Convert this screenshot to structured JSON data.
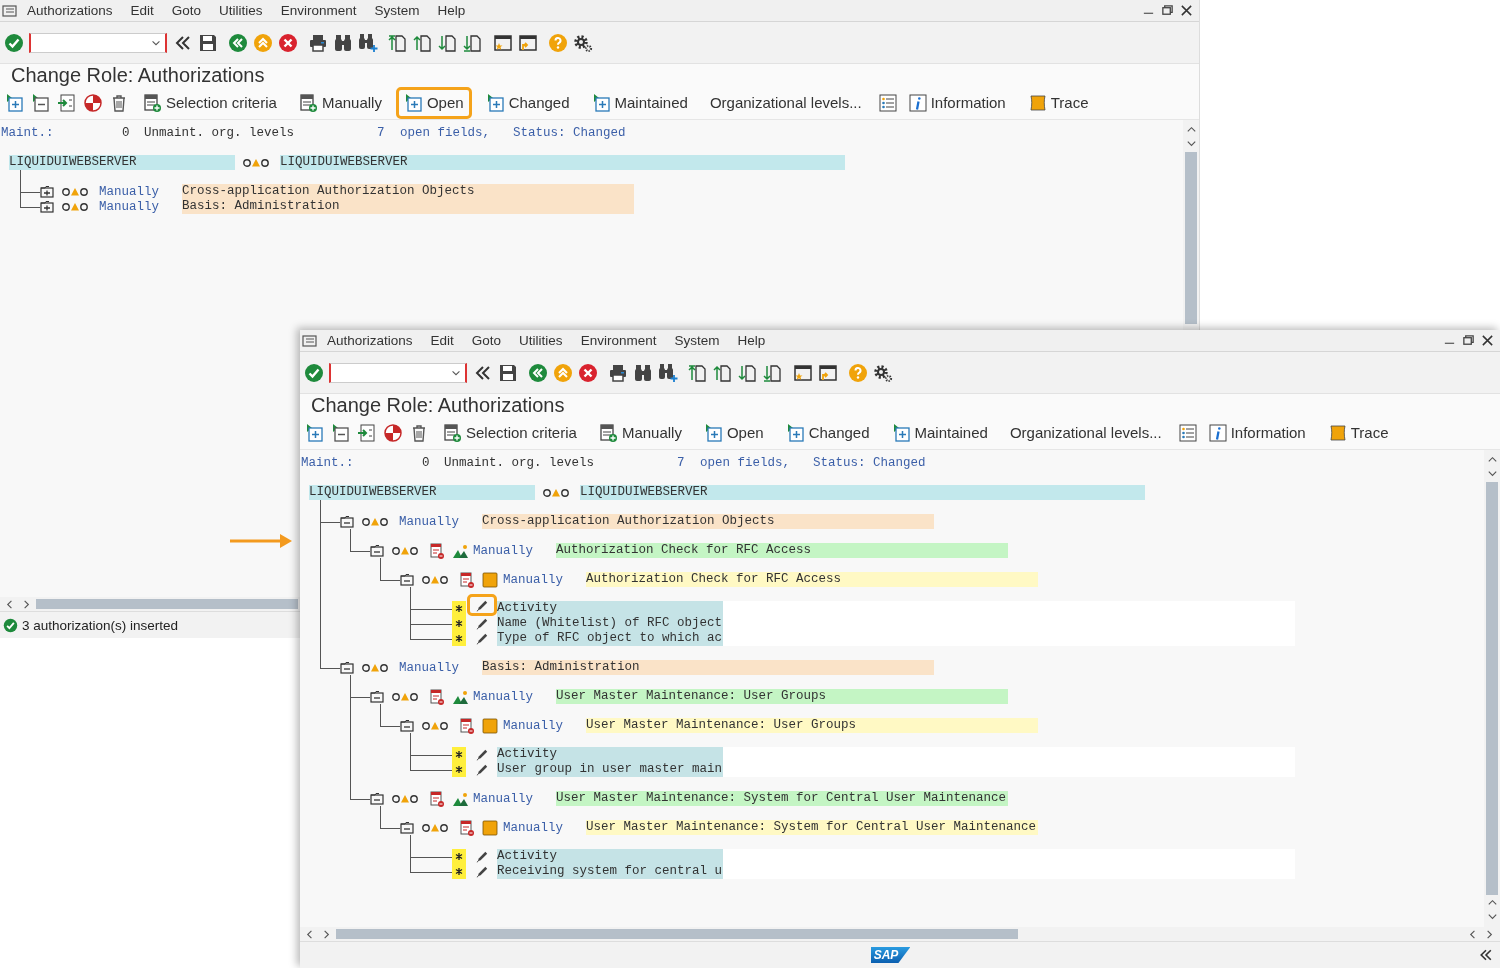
{
  "windows": [
    {
      "menu": [
        "Authorizations",
        "Edit",
        "Goto",
        "Utilities",
        "Environment",
        "System",
        "Help"
      ],
      "title": "Change Role: Authorizations",
      "app_toolbar": [
        {
          "label": "Selection criteria",
          "highlighted": false
        },
        {
          "label": "Manually",
          "highlighted": false
        },
        {
          "label": "Open",
          "highlighted": true
        },
        {
          "label": "Changed",
          "highlighted": false
        },
        {
          "label": "Maintained",
          "highlighted": false
        },
        {
          "label": "Organizational levels...",
          "highlighted": false
        },
        {
          "label": "Information",
          "highlighted": false
        },
        {
          "label": "Trace",
          "highlighted": false
        }
      ],
      "info": [
        {
          "text": "Maint.:",
          "link": true
        },
        {
          "text": "0",
          "link": false
        },
        {
          "text": "Unmaint. org. levels",
          "link": false
        },
        {
          "text": "7",
          "link": true
        },
        {
          "text": "open fields,",
          "link": true
        },
        {
          "text": "Status: Changed",
          "link": true
        }
      ],
      "tree": {
        "name": "LIQUIDUIWEBSERVER",
        "description": "LIQUIDUIWEBSERVER",
        "children": [
          {
            "kind": "class",
            "status": "Manually",
            "text": "Cross-application Authorization Objects",
            "expanded": false
          },
          {
            "kind": "class",
            "status": "Manually",
            "text": "Basis: Administration",
            "expanded": false
          }
        ]
      },
      "status_bar": {
        "message": "3 authorization(s) inserted"
      }
    },
    {
      "menu": [
        "Authorizations",
        "Edit",
        "Goto",
        "Utilities",
        "Environment",
        "System",
        "Help"
      ],
      "title": "Change Role: Authorizations",
      "app_toolbar": [
        {
          "label": "Selection criteria",
          "highlighted": false
        },
        {
          "label": "Manually",
          "highlighted": false
        },
        {
          "label": "Open",
          "highlighted": false
        },
        {
          "label": "Changed",
          "highlighted": false
        },
        {
          "label": "Maintained",
          "highlighted": false
        },
        {
          "label": "Organizational levels...",
          "highlighted": false
        },
        {
          "label": "Information",
          "highlighted": false
        },
        {
          "label": "Trace",
          "highlighted": false
        }
      ],
      "info": [
        {
          "text": "Maint.:",
          "link": true
        },
        {
          "text": "0",
          "link": false
        },
        {
          "text": "Unmaint. org. levels",
          "link": false
        },
        {
          "text": "7",
          "link": true
        },
        {
          "text": "open fields,",
          "link": true
        },
        {
          "text": "Status: Changed",
          "link": true
        }
      ],
      "tree": {
        "name": "LIQUIDUIWEBSERVER",
        "description": "LIQUIDUIWEBSERVER",
        "children": [
          {
            "kind": "class",
            "status": "Manually",
            "text": "Cross-application Authorization Objects",
            "expanded": true,
            "children": [
              {
                "kind": "object",
                "status": "Manually",
                "text": "Authorization Check for RFC Access",
                "expanded": true,
                "children": [
                  {
                    "kind": "authorization",
                    "status": "Manually",
                    "text": "Authorization Check for RFC Access",
                    "expanded": true,
                    "children": [
                      {
                        "kind": "field",
                        "text": "Activity",
                        "highlighted": true
                      },
                      {
                        "kind": "field",
                        "text": "Name (Whitelist) of RFC object",
                        "highlighted": false
                      },
                      {
                        "kind": "field",
                        "text": "Type of RFC object to which ac",
                        "highlighted": false
                      }
                    ]
                  }
                ]
              }
            ]
          },
          {
            "kind": "class",
            "status": "Manually",
            "text": "Basis: Administration",
            "expanded": true,
            "children": [
              {
                "kind": "object",
                "status": "Manually",
                "text": "User Master Maintenance: User Groups",
                "expanded": true,
                "children": [
                  {
                    "kind": "authorization",
                    "status": "Manually",
                    "text": "User Master Maintenance: User Groups",
                    "expanded": true,
                    "children": [
                      {
                        "kind": "field",
                        "text": "Activity",
                        "highlighted": false
                      },
                      {
                        "kind": "field",
                        "text": "User group in user master main",
                        "highlighted": false
                      }
                    ]
                  }
                ]
              },
              {
                "kind": "object",
                "status": "Manually",
                "text": "User Master Maintenance: System for Central User Maintenance",
                "expanded": true,
                "children": [
                  {
                    "kind": "authorization",
                    "status": "Manually",
                    "text": "User Master Maintenance: System for Central User Maintenance",
                    "expanded": true,
                    "children": [
                      {
                        "kind": "field",
                        "text": "Activity",
                        "highlighted": false
                      },
                      {
                        "kind": "field",
                        "text": "Receiving system for central u",
                        "highlighted": false
                      }
                    ]
                  }
                ]
              }
            ]
          }
        ]
      },
      "status_bar": {
        "logo": "SAP"
      }
    }
  ]
}
